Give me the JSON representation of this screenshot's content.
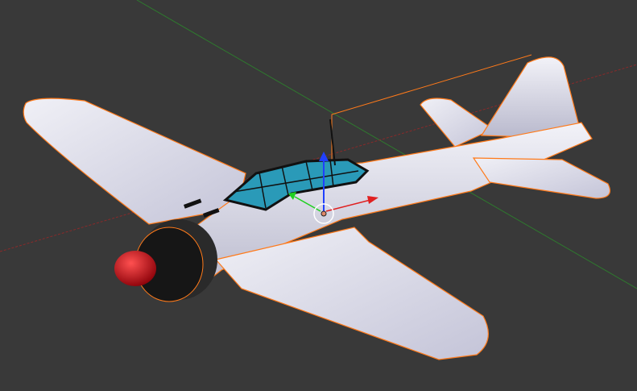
{
  "viewport": {
    "background_color": "#393939",
    "x_axis_color": "#8a2a2a",
    "y_axis_color": "#2e7a2e",
    "selection_outline_color": "#ff7a1a",
    "model": {
      "body_color": "#e2e2ee",
      "canopy_color": "#2a9ab8",
      "spinner_color": "#c0101a",
      "cowling_color": "#1c1c1c"
    },
    "gizmo": {
      "x_color": "#e02020",
      "y_color": "#20d020",
      "z_color": "#2040ff"
    }
  }
}
